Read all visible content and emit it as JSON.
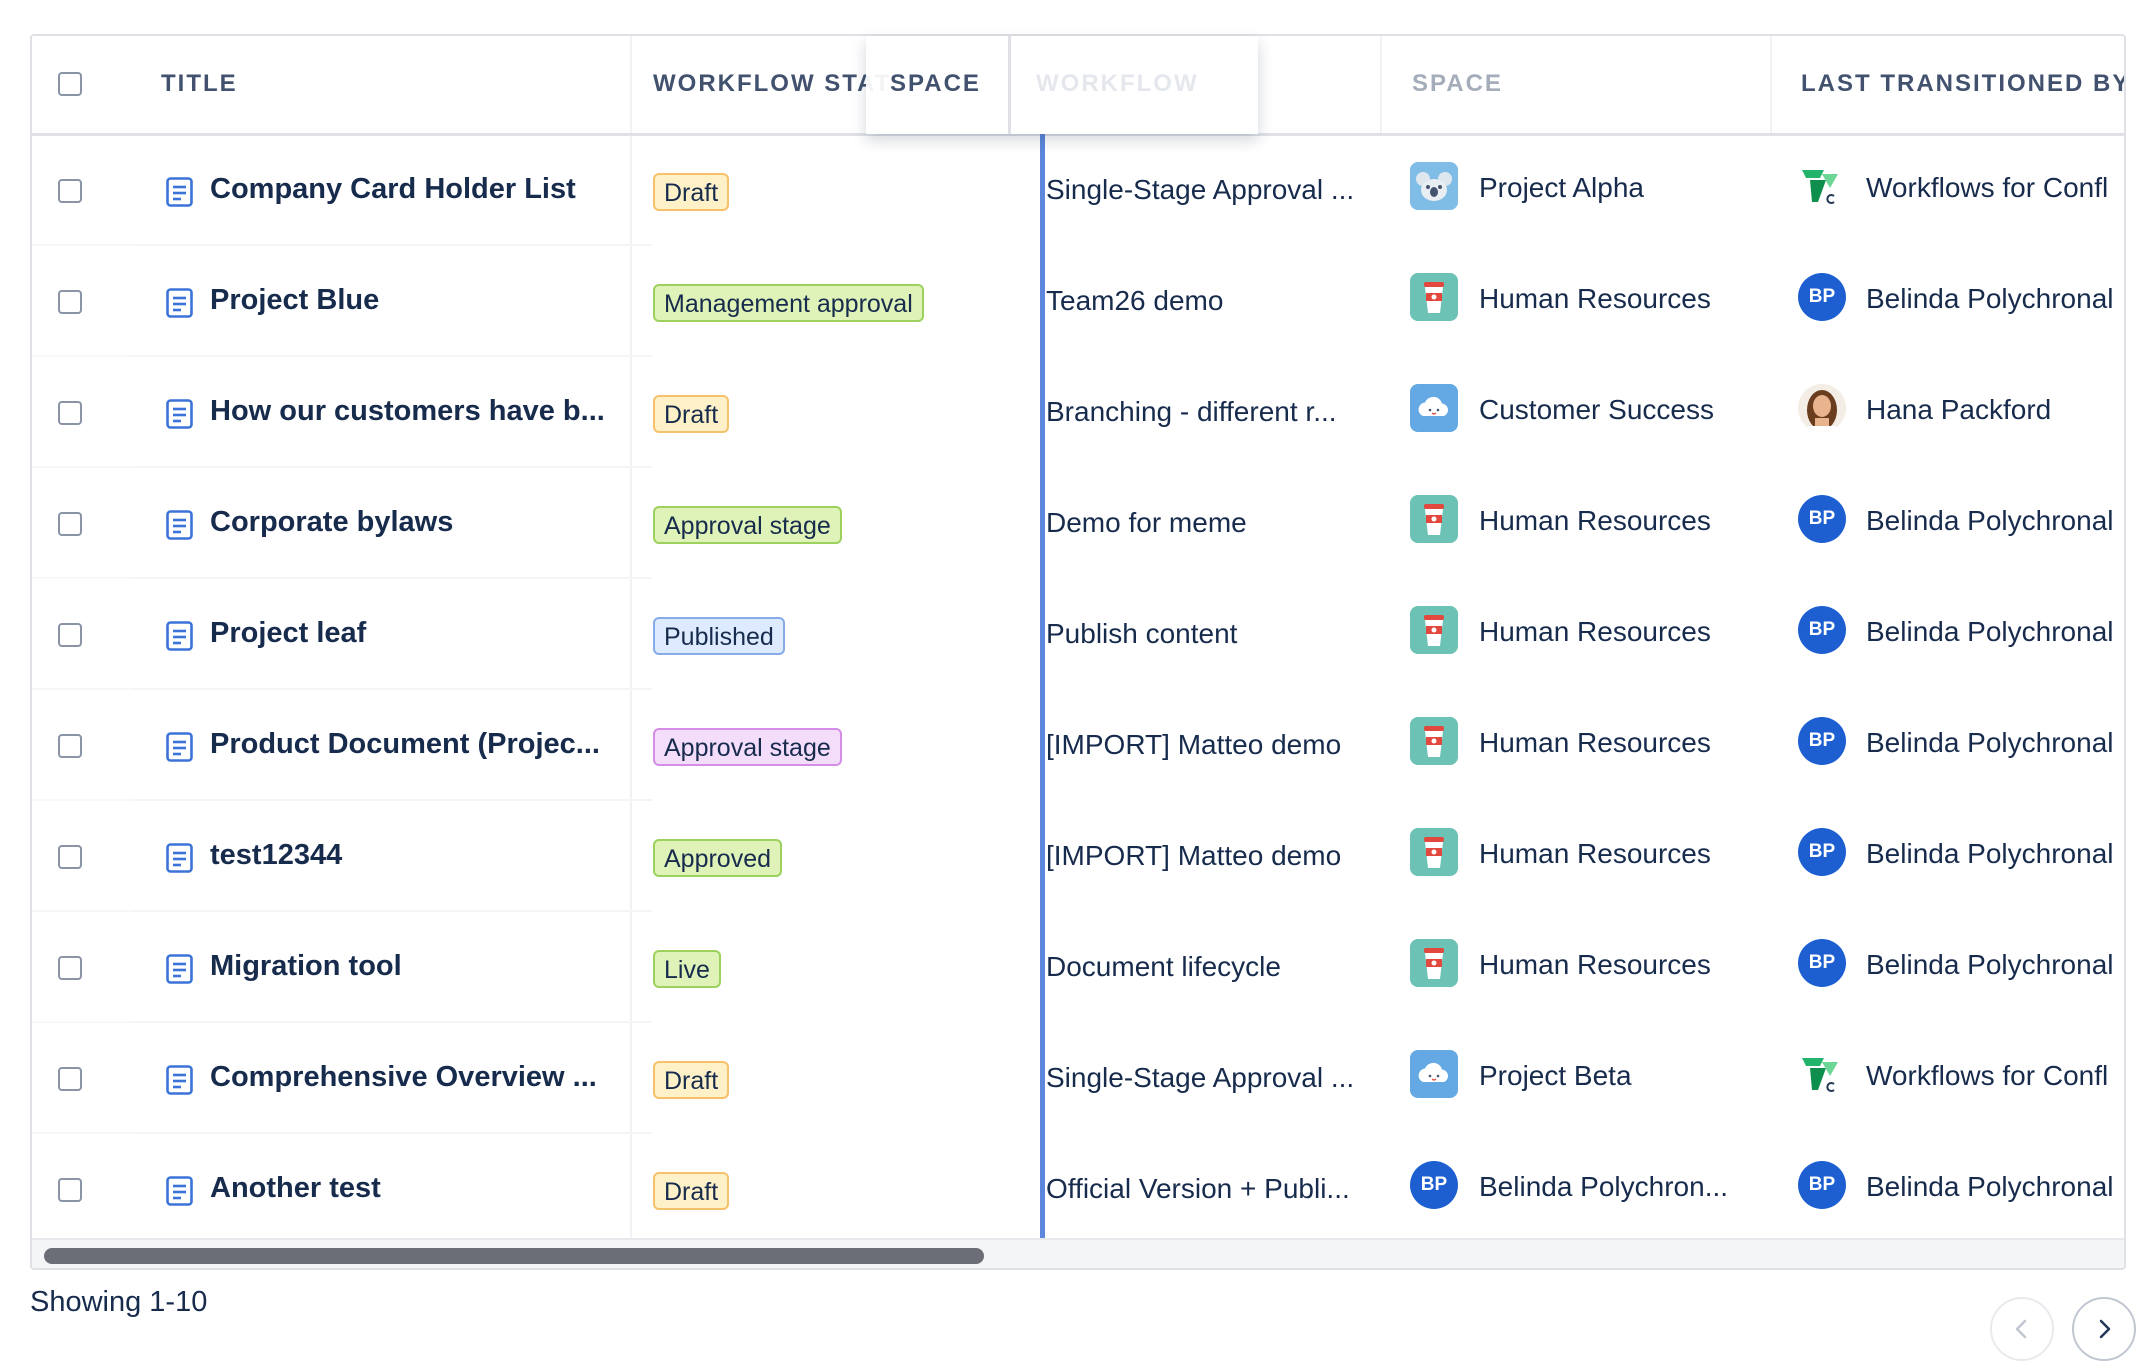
{
  "columns": {
    "title": "TITLE",
    "workflow_status": "WORKFLOW STAT",
    "dragged_space": "SPACE",
    "dragged_workflow": "WORKFLOW",
    "space": "SPACE",
    "last_transitioned_by": "LAST TRANSITIONED BY"
  },
  "colors": {
    "accent": "#5c87dc",
    "draft": {
      "bg": "#fff1c7",
      "border": "#f5c26b"
    },
    "management_approval": {
      "bg": "#dff3b8",
      "border": "#9bd15c"
    },
    "approval_stage_green": {
      "bg": "#dff3b8",
      "border": "#9bd15c"
    },
    "published": {
      "bg": "#deebff",
      "border": "#85abe8"
    },
    "approval_stage_purple": {
      "bg": "#f4dcfb",
      "border": "#d48ee8"
    },
    "approved": {
      "bg": "#dff3b8",
      "border": "#9bd15c"
    },
    "live": {
      "bg": "#dff3b8",
      "border": "#9bd15c"
    }
  },
  "rows": [
    {
      "title": "Company Card Holder List",
      "status": "Draft",
      "workflow": "Single-Stage Approval ...",
      "space": "Project Alpha",
      "space_icon": "koala-space-icon",
      "user": "Workflows for Confl",
      "user_icon": "workflows-app-icon"
    },
    {
      "title": "Project Blue",
      "status": "Management approval",
      "workflow": "Team26 demo",
      "space": "Human Resources",
      "space_icon": "coffee-cup-space-icon",
      "user": "Belinda Polychronal",
      "user_icon": "avatar-initials",
      "initials": "BP"
    },
    {
      "title": "How our customers have b...",
      "status": "Draft",
      "workflow": "Branching - different r...",
      "space": "Customer Success",
      "space_icon": "cloud-space-icon",
      "user": "Hana Packford",
      "user_icon": "avatar-photo"
    },
    {
      "title": "Corporate bylaws",
      "status": "Approval stage",
      "workflow": "Demo for meme",
      "space": "Human Resources",
      "space_icon": "coffee-cup-space-icon",
      "user": "Belinda Polychronal",
      "user_icon": "avatar-initials",
      "initials": "BP"
    },
    {
      "title": "Project leaf",
      "status": "Published",
      "workflow": "Publish content",
      "space": "Human Resources",
      "space_icon": "coffee-cup-space-icon",
      "user": "Belinda Polychronal",
      "user_icon": "avatar-initials",
      "initials": "BP"
    },
    {
      "title": "Product Document (Projec...",
      "status": "Approval stage",
      "workflow": "[IMPORT] Matteo demo",
      "space": "Human Resources",
      "space_icon": "coffee-cup-space-icon",
      "user": "Belinda Polychronal",
      "user_icon": "avatar-initials",
      "initials": "BP"
    },
    {
      "title": "test12344",
      "status": "Approved",
      "workflow": "[IMPORT] Matteo demo",
      "space": "Human Resources",
      "space_icon": "coffee-cup-space-icon",
      "user": "Belinda Polychronal",
      "user_icon": "avatar-initials",
      "initials": "BP"
    },
    {
      "title": "Migration tool",
      "status": "Live",
      "workflow": "Document lifecycle",
      "space": "Human Resources",
      "space_icon": "coffee-cup-space-icon",
      "user": "Belinda Polychronal",
      "user_icon": "avatar-initials",
      "initials": "BP"
    },
    {
      "title": "Comprehensive Overview ...",
      "status": "Draft",
      "workflow": "Single-Stage Approval ...",
      "space": "Project Beta",
      "space_icon": "cloud-space-icon",
      "user": "Workflows for Confl",
      "user_icon": "workflows-app-icon"
    },
    {
      "title": "Another test",
      "status": "Draft",
      "workflow": "Official Version + Publi...",
      "space": "Belinda Polychron...",
      "space_icon": "avatar-initials",
      "space_initials": "BP",
      "user": "Belinda Polychronal",
      "user_icon": "avatar-initials",
      "initials": "BP"
    }
  ],
  "footer": {
    "showing": "Showing 1-10",
    "prev_icon": "chevron-left-icon",
    "next_icon": "chevron-right-icon"
  }
}
